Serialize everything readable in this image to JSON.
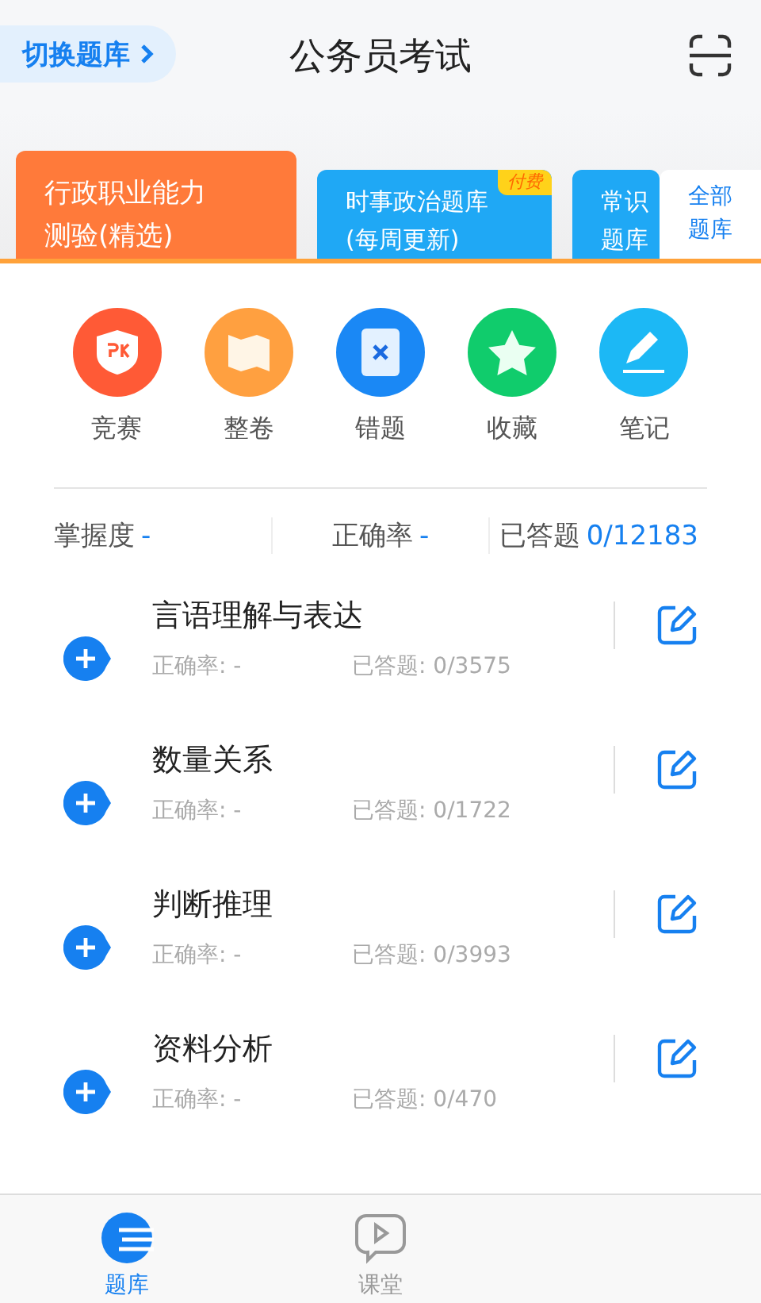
{
  "header": {
    "switch_button": "切换题库",
    "title": "公务员考试"
  },
  "banks": [
    {
      "lines": [
        "行政职业能力",
        "测验(精选)"
      ],
      "color": "#ff7a3a",
      "selected": true
    },
    {
      "lines": [
        "时事政治题库",
        "(每周更新)"
      ],
      "color": "#1fa8f5",
      "selected": false,
      "badge": "付费"
    },
    {
      "lines": [
        "常识",
        "题库"
      ],
      "color": "#1fa8f5",
      "selected": false
    }
  ],
  "all_banks": "全部题库",
  "tools": [
    {
      "kind": "pk",
      "label": "竞赛",
      "color": "#ff5a36"
    },
    {
      "kind": "book",
      "label": "整卷",
      "color": "#ffa040"
    },
    {
      "kind": "wrong",
      "label": "错题",
      "color": "#1a88f5"
    },
    {
      "kind": "star",
      "label": "收藏",
      "color": "#10cc6c"
    },
    {
      "kind": "pen",
      "label": "笔记",
      "color": "#1cb8f5"
    }
  ],
  "stats": [
    {
      "label": "掌握度",
      "value": "-"
    },
    {
      "label": "正确率",
      "value": "-"
    },
    {
      "label": "已答题",
      "value": "0/12183"
    }
  ],
  "subjects": [
    {
      "name": "言语理解与表达",
      "accuracy": "正确率: -",
      "answered": "已答题: 0/3575"
    },
    {
      "name": "数量关系",
      "accuracy": "正确率: -",
      "answered": "已答题: 0/1722"
    },
    {
      "name": "判断推理",
      "accuracy": "正确率: -",
      "answered": "已答题: 0/3993"
    },
    {
      "name": "资料分析",
      "accuracy": "正确率: -",
      "answered": "已答题: 0/470"
    }
  ],
  "nav": [
    {
      "kind": "bank",
      "label": "题库",
      "selected": true
    },
    {
      "kind": "class",
      "label": "课堂",
      "selected": false
    }
  ]
}
